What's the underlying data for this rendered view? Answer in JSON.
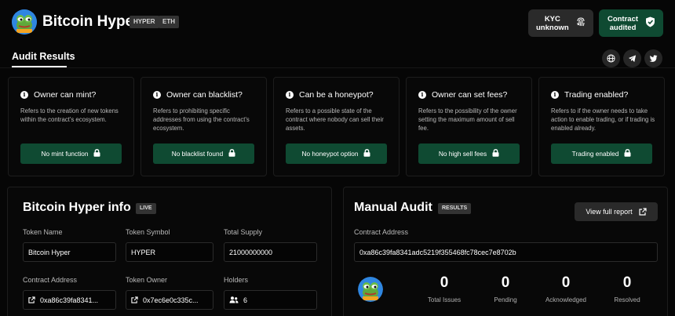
{
  "header": {
    "title": "Bitcoin Hyper",
    "tags": [
      "HYPER",
      "ETH"
    ],
    "kyc_label": "KYC unknown",
    "audit_label": "Contract audited",
    "logo_icon": "frog-logo-icon"
  },
  "tabs": {
    "active": "Audit Results"
  },
  "social": [
    "globe-icon",
    "telegram-icon",
    "twitter-icon"
  ],
  "checks": [
    {
      "title": "Owner can mint?",
      "desc": "Refers to the creation of new tokens within the contract's ecosystem.",
      "result": "No mint function"
    },
    {
      "title": "Owner can blacklist?",
      "desc": "Refers to prohibiting specific addresses from using the contract's ecosystem.",
      "result": "No blacklist found"
    },
    {
      "title": "Can be a honeypot?",
      "desc": "Refers to a possible state of the contract where nobody can sell their assets.",
      "result": "No honeypot option"
    },
    {
      "title": "Owner can set fees?",
      "desc": "Refers to the possibility of the owner setting the maximum amount of sell fee.",
      "result": "No high sell fees"
    },
    {
      "title": "Trading enabled?",
      "desc": "Refers to if the owner needs to take action to enable trading, or if trading is enabled already.",
      "result": "Trading enabled"
    }
  ],
  "info": {
    "title": "Bitcoin Hyper info",
    "badge": "LIVE",
    "token_name_label": "Token Name",
    "token_name": "Bitcoin Hyper",
    "token_symbol_label": "Token Symbol",
    "token_symbol": "HYPER",
    "total_supply_label": "Total Supply",
    "total_supply": "21000000000",
    "contract_label": "Contract Address",
    "contract_short": "0xa86c39fa8341...",
    "owner_label": "Token Owner",
    "owner_short": "0x7ec6e0c335c...",
    "holders_label": "Holders",
    "holders": "6"
  },
  "manual": {
    "title": "Manual Audit",
    "badge": "RESULTS",
    "report_button": "View full report",
    "contract_label": "Contract Address",
    "contract_full": "0xa86c39fa8341adc5219f355468fc78cec7e8702b",
    "stats": [
      {
        "value": "0",
        "label": "Total Issues"
      },
      {
        "value": "0",
        "label": "Pending"
      },
      {
        "value": "0",
        "label": "Acknowledged"
      },
      {
        "value": "0",
        "label": "Resolved"
      }
    ]
  }
}
